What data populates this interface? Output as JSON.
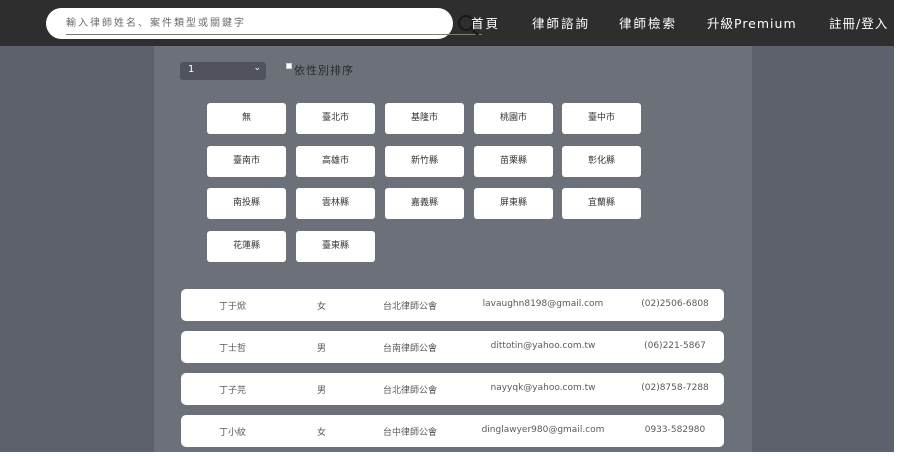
{
  "header": {
    "search_placeholder": "輸入律師姓名、案件類型或關鍵字",
    "nav": {
      "home": "首頁",
      "consult": "律師諮詢",
      "search": "律師檢索",
      "premium": "升級Premium",
      "login": "註冊/登入"
    }
  },
  "controls": {
    "page_select": {
      "value": "1",
      "options": [
        "1"
      ]
    },
    "sort_by_gender": {
      "label": "依性別排序",
      "checked": false
    }
  },
  "cities": [
    "無",
    "臺北市",
    "基隆市",
    "桃園市",
    "臺中市",
    "臺南市",
    "高雄市",
    "新竹縣",
    "苗栗縣",
    "彰化縣",
    "南投縣",
    "雲林縣",
    "嘉義縣",
    "屏東縣",
    "宜蘭縣",
    "花蓮縣",
    "臺東縣"
  ],
  "lawyers": [
    {
      "name": "丁于焮",
      "gender": "女",
      "association": "台北律師公會",
      "email": "lavaughn8198@gmail.com",
      "phone": "(02)2506-6808"
    },
    {
      "name": "丁士哲",
      "gender": "男",
      "association": "台南律師公會",
      "email": "dittotin@yahoo.com.tw",
      "phone": "(06)221-5867"
    },
    {
      "name": "丁子芫",
      "gender": "男",
      "association": "台北律師公會",
      "email": "nayyqk@yahoo.com.tw",
      "phone": "(02)8758-7288"
    },
    {
      "name": "丁小紋",
      "gender": "女",
      "association": "台中律師公會",
      "email": "dinglawyer980@gmail.com",
      "phone": "0933-582980"
    }
  ]
}
